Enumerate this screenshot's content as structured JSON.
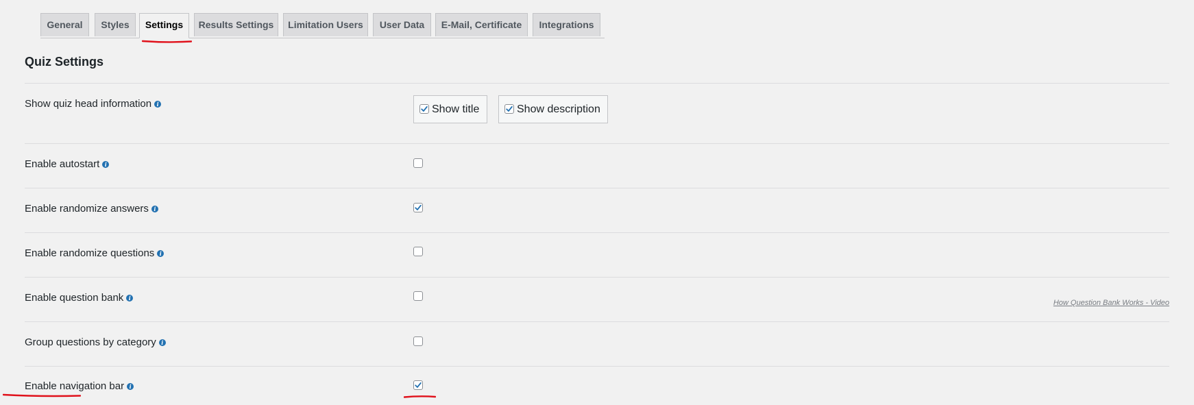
{
  "tabs": [
    {
      "label": "General",
      "active": false
    },
    {
      "label": "Styles",
      "active": false
    },
    {
      "label": "Settings",
      "active": true
    },
    {
      "label": "Results Settings",
      "active": false
    },
    {
      "label": "Limitation Users",
      "active": false
    },
    {
      "label": "User Data",
      "active": false
    },
    {
      "label": "E-Mail, Certificate",
      "active": false
    },
    {
      "label": "Integrations",
      "active": false
    }
  ],
  "section_title": "Quiz Settings",
  "settings": {
    "head_info": {
      "label": "Show quiz head information",
      "options": [
        {
          "label": "Show title",
          "checked": true
        },
        {
          "label": "Show description",
          "checked": true
        }
      ]
    },
    "autostart": {
      "label": "Enable autostart",
      "checked": false
    },
    "randomize_answers": {
      "label": "Enable randomize answers",
      "checked": true
    },
    "randomize_questions": {
      "label": "Enable randomize questions",
      "checked": false
    },
    "question_bank": {
      "label": "Enable question bank",
      "checked": false,
      "link": "How Question Bank Works - Video"
    },
    "group_by_category": {
      "label": "Group questions by category",
      "checked": false
    },
    "navigation_bar": {
      "label": "Enable navigation bar",
      "checked": true
    }
  },
  "icons": {
    "info": "info-icon",
    "check": "checkmark-icon"
  },
  "colors": {
    "accent": "#2271b1",
    "annotation": "#e0111b"
  }
}
